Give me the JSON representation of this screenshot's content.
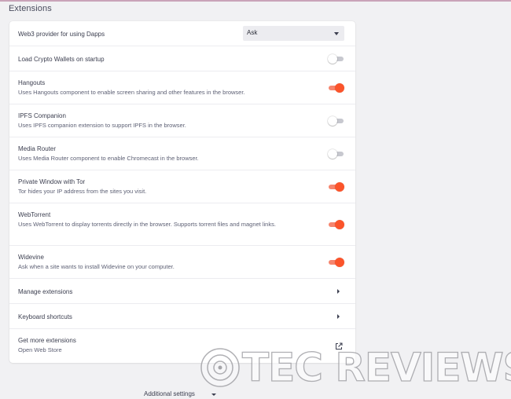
{
  "section": {
    "title": "Extensions"
  },
  "rows": [
    {
      "label": "Web3 provider for using Dapps",
      "control": "select",
      "value": "Ask"
    },
    {
      "label": "Load Crypto Wallets on startup",
      "control": "toggle",
      "enabled": false
    },
    {
      "label": "Hangouts",
      "description": "Uses Hangouts component to enable screen sharing and other features in the browser.",
      "control": "toggle",
      "enabled": true
    },
    {
      "label": "IPFS Companion",
      "description": "Uses IPFS companion extension to support IPFS in the browser.",
      "control": "toggle",
      "enabled": false
    },
    {
      "label": "Media Router",
      "description": "Uses Media Router component to enable Chromecast in the browser.",
      "control": "toggle",
      "enabled": false
    },
    {
      "label": "Private Window with Tor",
      "description": "Tor hides your IP address from the sites you visit.",
      "control": "toggle",
      "enabled": true
    },
    {
      "label": "WebTorrent",
      "description": "Uses WebTorrent to display torrents directly in the browser. Supports torrent files and magnet links.",
      "control": "toggle",
      "enabled": true
    },
    {
      "label": "Widevine",
      "description": "Ask when a site wants to install Widevine on your computer.",
      "control": "toggle",
      "enabled": true
    },
    {
      "label": "Manage extensions",
      "control": "chevron"
    },
    {
      "label": "Keyboard shortcuts",
      "control": "chevron"
    },
    {
      "label": "Get more extensions",
      "description": "Open Web Store",
      "control": "external-link"
    }
  ],
  "footer": {
    "additional_settings": "Additional settings"
  },
  "watermark": {
    "text": "TEC REVIEWS"
  },
  "icons": {
    "select_caret": "caret-down-icon",
    "chevron": "chevron-right-icon",
    "external": "external-link-icon",
    "footer_caret": "caret-down-icon"
  },
  "colors": {
    "accent": "#fb542b",
    "toggle_on_track": "#f6856e",
    "toggle_off_track": "#c7c8cf",
    "background": "#f1f1f3",
    "card": "#ffffff"
  }
}
